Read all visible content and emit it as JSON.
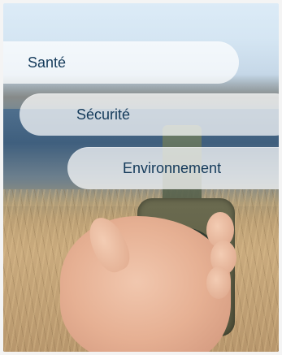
{
  "menu": {
    "items": [
      {
        "label": "Santé"
      },
      {
        "label": "Sécurité"
      },
      {
        "label": "Environnement"
      }
    ]
  },
  "background": {
    "image": "hand-holding-compass-photo"
  },
  "colors": {
    "pill_background": "#ffffffb8",
    "label_text": "#143a5a"
  }
}
